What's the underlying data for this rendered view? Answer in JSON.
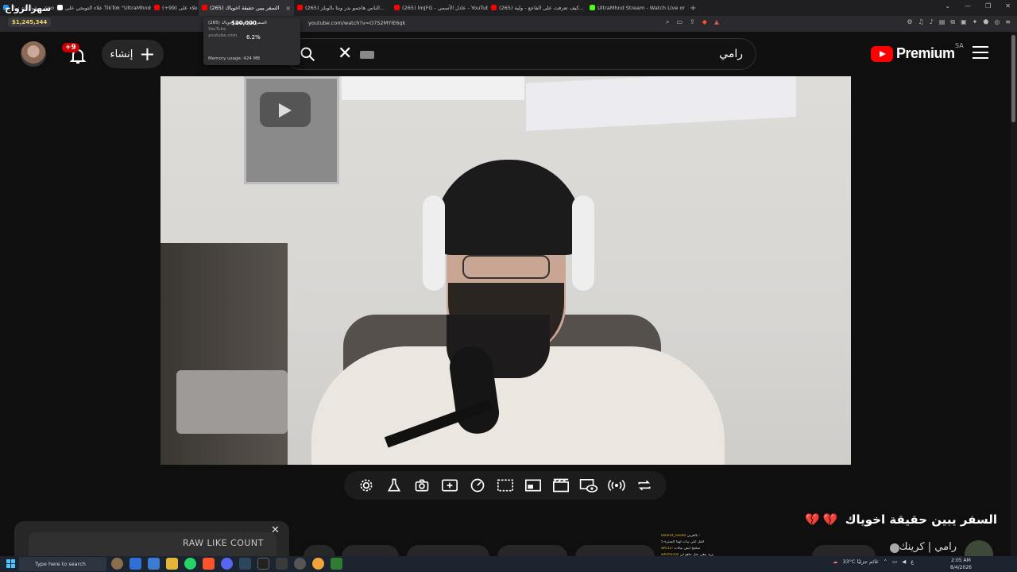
{
  "browser": {
    "tabs": [
      {
        "label": "\"يقول إن سا... soon X",
        "favicon": "#1d9bf0"
      },
      {
        "label": "علاء التويجي على TikTok \"UltraMhnd\"",
        "favicon": "#ffffff"
      },
      {
        "label": "(+99) علاء على",
        "favicon": "#ff0000"
      },
      {
        "label": "(265) السفر يبين حقيقة اخوياك",
        "favicon": "#ff0000",
        "active": true
      },
      {
        "label": "(265) الناس هاجمو بدر وبثا بالوبلز...",
        "favicon": "#ff0000"
      },
      {
        "label": "(265) lmJFG - عادل الأسمي - YouTube",
        "favicon": "#ff0000"
      },
      {
        "label": "(265) كيف تعرفت على الفاجع - ولية...",
        "favicon": "#ff0000"
      },
      {
        "label": "UltraMhnd Stream - Watch Live on K...",
        "favicon": "#53fc18"
      }
    ],
    "url": "youtube.com/watch?v=O7S2MYIE6qk",
    "donation": "$1,245,344",
    "hover_card": {
      "title": "(265) السفر يبين حقيقة اخوياك",
      "site": "YouTube",
      "domain": "youtube.com",
      "memory": "Memory usage: 424 MB"
    }
  },
  "stream_overlay": {
    "title": "سهرالزواج",
    "goal_amount": "$20,000",
    "goal_percent": "6.2%"
  },
  "youtube": {
    "logo_text": "Premium",
    "country": "SA",
    "search_value": "رامي",
    "create_label": "إنشاء",
    "notification_count": "+9"
  },
  "video": {
    "title": "السفر يبين حقيقة اخوياك",
    "channel": "رامي | كرينك"
  },
  "widget": {
    "label": "RAW LIKE COUNT"
  },
  "chat": [
    {
      "user": "lazaret_saudo",
      "msg": "بالعربي :"
    },
    {
      "user": "",
      "msg": "اقتل ابلي يبات لهذا السترة 5"
    },
    {
      "user": "aRr12: ",
      "msg": "صحيح ايش بيانات"
    },
    {
      "user": "whimsical ",
      "msg": "يريد يبقي مثل ماهو لي"
    },
    {
      "user": "choisfrom",
      "msg": "بالعبء والله :"
    },
    {
      "user": "CRAY_YARO",
      "msg": "عن ابو ماقل عشان :"
    }
  ],
  "taskbar": {
    "search_placeholder": "Type here to search",
    "weather": "33°C  غائم جزئيًا",
    "time": "2:05 AM",
    "date": "8/4/2026"
  },
  "colors": {
    "accent": "#ff0000",
    "badge": "#cc0000",
    "background": "#0f0f0f"
  }
}
